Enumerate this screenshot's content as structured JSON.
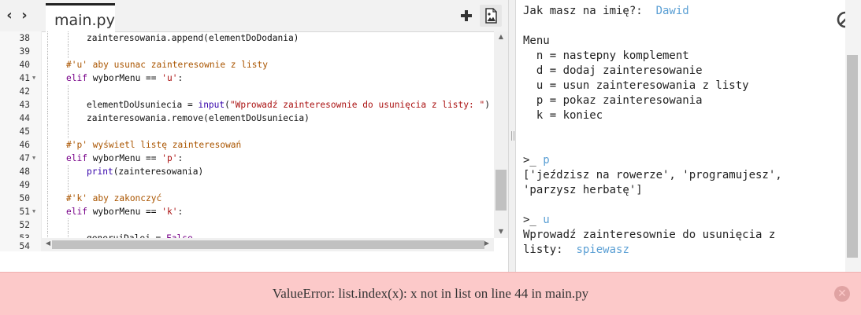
{
  "editor": {
    "tab_label": "main.py",
    "nav_back": "‹",
    "nav_forward": "›",
    "add_icon": "plus-icon",
    "image_icon": "image-file-icon",
    "lines": [
      {
        "n": "38",
        "fold": false,
        "indent": 2,
        "err": false,
        "parts": [
          {
            "t": "zainteresowania.append(elementDoDodania)",
            "c": ""
          }
        ]
      },
      {
        "n": "39",
        "fold": false,
        "indent": 2,
        "err": false,
        "parts": []
      },
      {
        "n": "40",
        "fold": false,
        "indent": 1,
        "err": false,
        "parts": [
          {
            "t": "#'u' aby usunac zainteresownie z listy",
            "c": "c"
          }
        ]
      },
      {
        "n": "41",
        "fold": true,
        "indent": 1,
        "err": false,
        "parts": [
          {
            "t": "elif",
            "c": "k"
          },
          {
            "t": " wyborMenu == ",
            "c": ""
          },
          {
            "t": "'u'",
            "c": "s"
          },
          {
            "t": ":",
            "c": ""
          }
        ]
      },
      {
        "n": "42",
        "fold": false,
        "indent": 2,
        "err": false,
        "parts": []
      },
      {
        "n": "43",
        "fold": false,
        "indent": 2,
        "err": false,
        "parts": [
          {
            "t": "elementDoUsuniecia = ",
            "c": ""
          },
          {
            "t": "input",
            "c": "b"
          },
          {
            "t": "(",
            "c": ""
          },
          {
            "t": "\"Wprowadź zainteresownie do usunięcia z listy: \"",
            "c": "s"
          },
          {
            "t": ")",
            "c": ""
          }
        ]
      },
      {
        "n": "44",
        "fold": false,
        "indent": 2,
        "err": true,
        "parts": [
          {
            "t": "zainteresowania.remove(elementDoUsuniecia)",
            "c": ""
          }
        ]
      },
      {
        "n": "45",
        "fold": false,
        "indent": 2,
        "err": false,
        "parts": []
      },
      {
        "n": "46",
        "fold": false,
        "indent": 1,
        "err": false,
        "parts": [
          {
            "t": "#'p' wyświetl listę zainteresowań",
            "c": "c"
          }
        ]
      },
      {
        "n": "47",
        "fold": true,
        "indent": 1,
        "err": false,
        "parts": [
          {
            "t": "elif",
            "c": "k"
          },
          {
            "t": " wyborMenu == ",
            "c": ""
          },
          {
            "t": "'p'",
            "c": "s"
          },
          {
            "t": ":",
            "c": ""
          }
        ]
      },
      {
        "n": "48",
        "fold": false,
        "indent": 2,
        "err": false,
        "parts": [
          {
            "t": "print",
            "c": "b"
          },
          {
            "t": "(zainteresowania)",
            "c": ""
          }
        ]
      },
      {
        "n": "49",
        "fold": false,
        "indent": 2,
        "err": false,
        "parts": []
      },
      {
        "n": "50",
        "fold": false,
        "indent": 1,
        "err": false,
        "parts": [
          {
            "t": "#'k' aby zakonczyć",
            "c": "c"
          }
        ]
      },
      {
        "n": "51",
        "fold": true,
        "indent": 1,
        "err": false,
        "parts": [
          {
            "t": "elif",
            "c": "k"
          },
          {
            "t": " wyborMenu == ",
            "c": ""
          },
          {
            "t": "'k'",
            "c": "s"
          },
          {
            "t": ":",
            "c": ""
          }
        ]
      },
      {
        "n": "52",
        "fold": false,
        "indent": 2,
        "err": false,
        "parts": []
      },
      {
        "n": "53",
        "fold": false,
        "indent": 2,
        "err": false,
        "parts": [
          {
            "t": "generujDalej = ",
            "c": ""
          },
          {
            "t": "False",
            "c": "k"
          }
        ]
      }
    ],
    "last_line_number": "54"
  },
  "console": {
    "lines": [
      [
        {
          "t": "Jak masz na imię?:  ",
          "u": false
        },
        {
          "t": "Dawid",
          "u": true
        }
      ],
      [],
      [
        {
          "t": "Menu",
          "u": false
        }
      ],
      [
        {
          "t": "  n = nastepny komplement",
          "u": false
        }
      ],
      [
        {
          "t": "  d = dodaj zainteresowanie",
          "u": false
        }
      ],
      [
        {
          "t": "  u = usun zainteresowania z listy",
          "u": false
        }
      ],
      [
        {
          "t": "  p = pokaz zainteresowania",
          "u": false
        }
      ],
      [
        {
          "t": "  k = koniec",
          "u": false
        }
      ],
      [],
      [],
      [
        {
          "t": ">_ ",
          "u": false
        },
        {
          "t": "p",
          "u": true
        }
      ],
      [
        {
          "t": "['jeździsz na rowerze', 'programujesz',",
          "u": false
        }
      ],
      [
        {
          "t": "'parzysz herbatę']",
          "u": false
        }
      ],
      [],
      [
        {
          "t": ">_ ",
          "u": false
        },
        {
          "t": "u",
          "u": true
        }
      ],
      [
        {
          "t": "Wprowadź zainteresownie do usunięcia z",
          "u": false
        }
      ],
      [
        {
          "t": "listy:  ",
          "u": false
        },
        {
          "t": "spiewasz",
          "u": true
        }
      ]
    ],
    "stop_icon": "stop-icon"
  },
  "error": {
    "message": "ValueError: list.index(x): x not in list on line 44 in main.py",
    "close_glyph": "✕"
  },
  "colors": {
    "error_background": "#fcc9c9",
    "error_line_highlight": "#ffd2d2",
    "user_input": "#5a9fd4",
    "keyword": "#770088",
    "string": "#aa1111",
    "comment": "#aa5500"
  }
}
